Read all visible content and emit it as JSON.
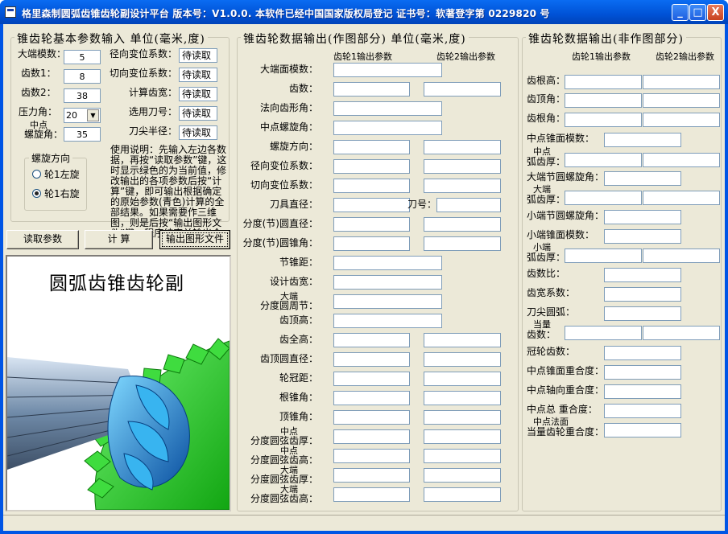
{
  "window": {
    "title": "格里森制圆弧齿锥齿轮副设计平台 版本号：V1.0.0.  本软件已经中国国家版权局登记  证书号：软著登字第 0229820 号",
    "minimize": "_",
    "maximize": "□",
    "close": "X"
  },
  "basic": {
    "legend": "锥齿轮基本参数输入 单位(毫米,度)",
    "module_label": "大端模数：",
    "module": "5",
    "z1_label": "齿数1：",
    "z1": "8",
    "z2_label": "齿数2：",
    "z2": "38",
    "pressure_label": "压力角：",
    "pressure": "20",
    "spiral_label_top": "中点",
    "spiral_label": "螺旋角：",
    "spiral": "35",
    "radial_shift_label": "径向变位系数：",
    "tangential_shift_label": "切向变位系数：",
    "face_width_label": "计算齿宽：",
    "cutter_label": "选用刀号：",
    "tip_radius_label": "刀尖半径：",
    "pending": "待读取",
    "direction_legend": "螺旋方向",
    "left_hand": "轮1左旋",
    "right_hand": "轮1右旋",
    "instructions": "使用说明：先输入左边各数据，再按“读取参数”键，这时显示绿色的为当前值，修改输出的各项参数后按“计算”键，即可输出根据确定的原始参数(青色)计算的全部结果。如果需要作三维图，则是后按“输出图形文件”键，程序结束并输出全部文件。"
  },
  "buttons": {
    "read": "读取参数",
    "calc": "计  算",
    "export": "输出图形文件"
  },
  "image": {
    "title": "圆弧齿锥齿轮副"
  },
  "mid": {
    "legend": "锥齿轮数据输出(作图部分) 单位(毫米,度)",
    "col1": "齿轮1输出参数",
    "col2": "齿轮2输出参数",
    "rows": [
      {
        "label": "大端面模数："
      },
      {
        "label": "齿数："
      },
      {
        "label": "法向齿形角："
      },
      {
        "label": "中点螺旋角："
      },
      {
        "label": "螺旋方向："
      },
      {
        "label": "径向变位系数："
      },
      {
        "label": "切向变位系数："
      },
      {
        "label": "刀具直径："
      },
      {
        "label": "分度(节)圆直径："
      },
      {
        "label": "分度(节)圆锥角："
      },
      {
        "label": "节锥距："
      },
      {
        "label": "设计齿宽："
      },
      {
        "label_top": "大端",
        "label": "分度圆周节："
      },
      {
        "label": "齿顶高："
      },
      {
        "label": "齿全高："
      },
      {
        "label": "齿顶圆直径："
      },
      {
        "label": "轮冠距："
      },
      {
        "label": "根锥角："
      },
      {
        "label": "顶锥角："
      },
      {
        "label_top": "中点",
        "label": "分度圆弦齿厚："
      },
      {
        "label_top": "中点",
        "label": "分度圆弦齿高："
      },
      {
        "label_top": "大端",
        "label": "分度圆弦齿厚："
      },
      {
        "label_top": "大端",
        "label": "分度圆弦齿高："
      }
    ],
    "cutter_no_label": "刀号："
  },
  "right": {
    "legend": "锥齿轮数据输出(非作图部分)",
    "col1": "齿轮1输出参数",
    "col2": "齿轮2输出参数",
    "rows": [
      {
        "label": "齿根高："
      },
      {
        "label": "齿顶角："
      },
      {
        "label": "齿根角："
      },
      {
        "label": "中点锥面模数："
      },
      {
        "label_top": "中点",
        "label": "弧齿厚："
      },
      {
        "label": "大端节圆螺旋角："
      },
      {
        "label_top": "大端",
        "label": "弧齿厚："
      },
      {
        "label": "小端节圆螺旋角："
      },
      {
        "label": "小端锥面模数："
      },
      {
        "label_top": "小端",
        "label": "弧齿厚："
      },
      {
        "label": "齿数比："
      },
      {
        "label": "齿宽系数："
      },
      {
        "label": "刀尖圆弧："
      },
      {
        "label_top": "当量",
        "label": "齿数："
      },
      {
        "label": "冠轮齿数："
      },
      {
        "label": "中点锥面重合度："
      },
      {
        "label": "中点轴向重合度："
      },
      {
        "label": "中点总  重合度："
      },
      {
        "label_top": "中点法面",
        "label": "当量齿轮重合度："
      }
    ]
  },
  "colors": {
    "titlebar": "#0055e5",
    "face": "#ece9d8",
    "gear_green": "#2ecc2e",
    "pinion_blue": "#1e8fd8"
  }
}
